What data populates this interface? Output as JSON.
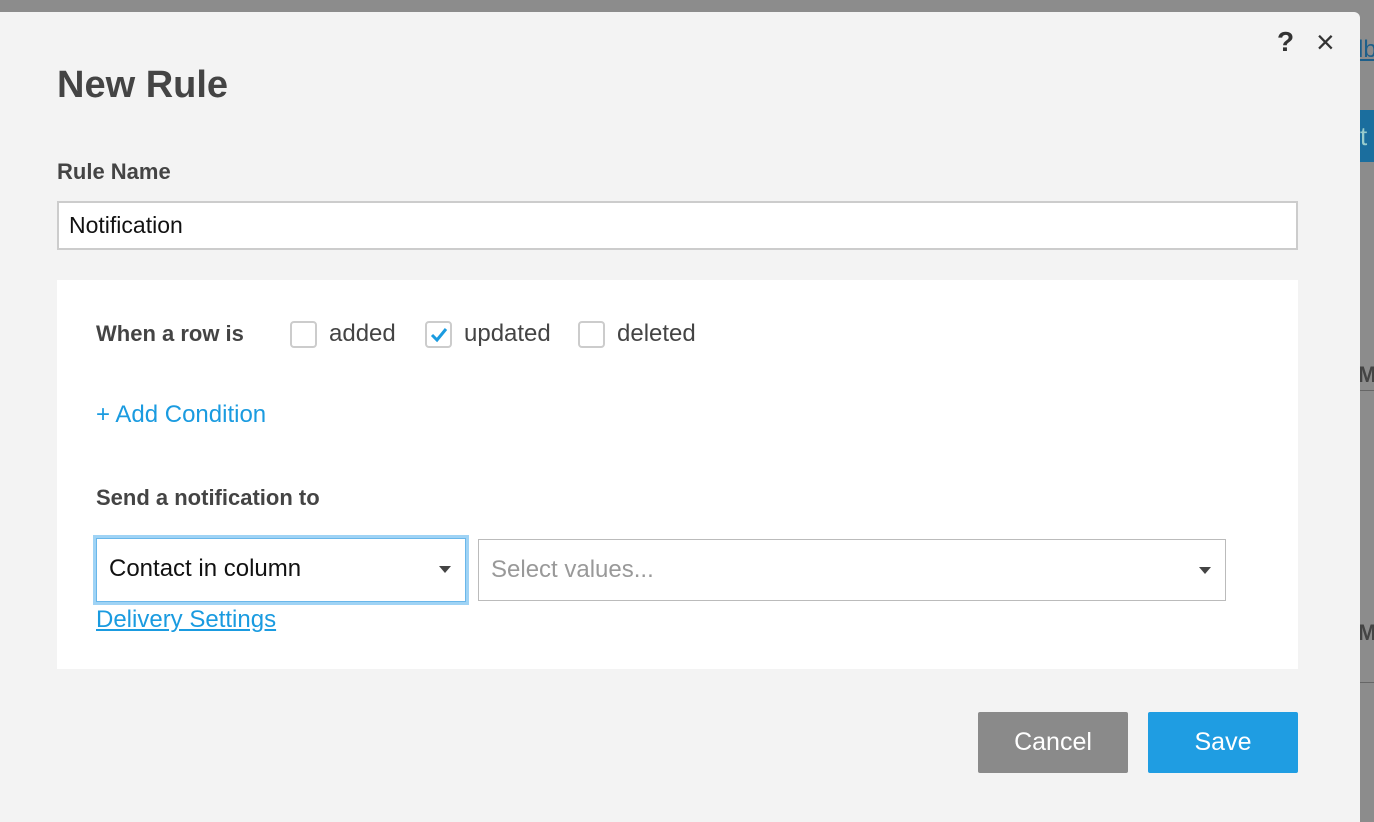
{
  "background": {
    "link_fragment": "lb",
    "button_fragment": "t",
    "row_fragments": [
      "M",
      "M"
    ]
  },
  "modal": {
    "title": "New Rule",
    "help_label": "?",
    "close_label": "×",
    "rule_name": {
      "label": "Rule Name",
      "value": "Notification"
    },
    "trigger": {
      "label": "When a row is",
      "options": [
        {
          "label": "added",
          "checked": false
        },
        {
          "label": "updated",
          "checked": true
        },
        {
          "label": "deleted",
          "checked": false
        }
      ]
    },
    "add_condition": {
      "icon": "plus-icon",
      "label": "+ Add Condition"
    },
    "send_to": {
      "label": "Send a notification to",
      "recipient_type": "Contact in column",
      "values_placeholder": "Select values..."
    },
    "delivery_settings": "Delivery Settings",
    "buttons": {
      "cancel": "Cancel",
      "save": "Save"
    },
    "colors": {
      "accent": "#1f9de2",
      "cancel": "#8a8a8a",
      "check": "#1a9be0"
    }
  }
}
